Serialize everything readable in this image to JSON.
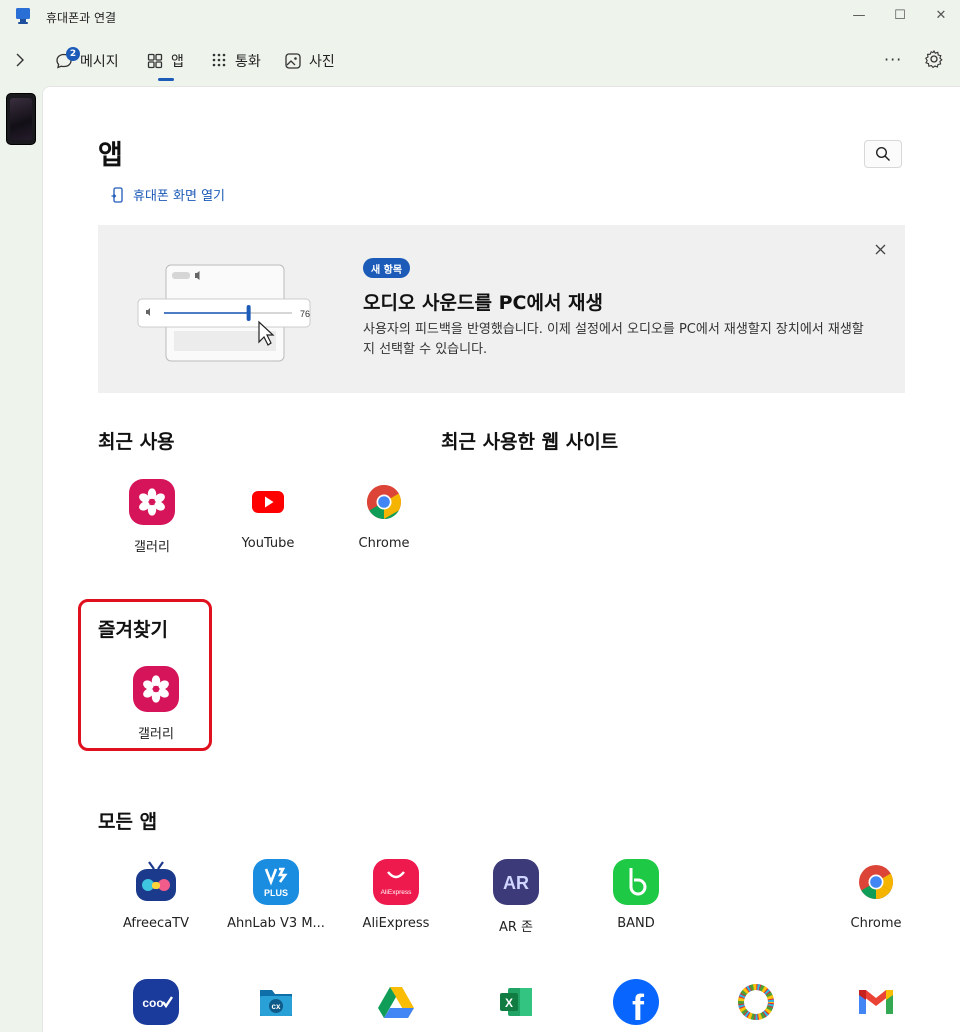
{
  "window": {
    "title": "휴대폰과 연결",
    "minimize": "—",
    "maximize": "☐",
    "close": "✕"
  },
  "nav": {
    "tabs": [
      {
        "label": "메시지",
        "badge": "2"
      },
      {
        "label": "앱"
      },
      {
        "label": "통화"
      },
      {
        "label": "사진"
      }
    ],
    "more": "···"
  },
  "page": {
    "title": "앱",
    "open_screen": "휴대폰 화면 열기"
  },
  "banner": {
    "chip": "새 항목",
    "title": "오디오 사운드를 PC에서 재생",
    "description": "사용자의 피드백을 반영했습니다. 이제 설정에서 오디오를 PC에서 재생할지 장치에서 재생할지 선택할 수 있습니다.",
    "slider_value": "76",
    "slider_fraction": 0.76
  },
  "sections": {
    "recent": "최근 사용",
    "recent_web": "최근 사용한 웹 사이트",
    "favorites": "즐겨찾기",
    "all_apps": "모든 앱"
  },
  "recent_apps": [
    "갤러리",
    "YouTube",
    "Chrome"
  ],
  "favorite_apps": [
    "갤러리"
  ],
  "all_apps": [
    "AfreecaTV",
    "AhnLab V3 M...",
    "AliExpress",
    "AR 존",
    "BAND",
    "Chrome"
  ],
  "icon_text": {
    "ar": "AR",
    "coov": "coo",
    "cx": "cx",
    "excel": "X",
    "facebook": "f",
    "v3": "PLUS",
    "aliexpress": "AliExpress"
  },
  "colors": {
    "accent": "#1c5bb8",
    "gallery": "#d5145a",
    "highlight": "#e0101e"
  }
}
